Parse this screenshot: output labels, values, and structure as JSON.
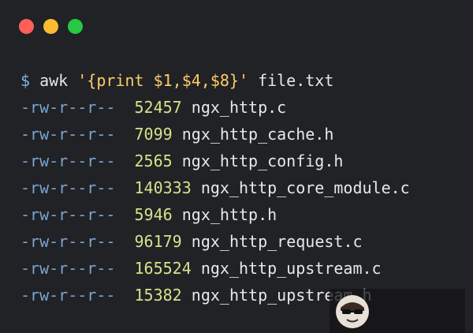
{
  "window": {
    "controls": [
      {
        "name": "close",
        "color": "#ff5f57"
      },
      {
        "name": "minimize",
        "color": "#febc2e"
      },
      {
        "name": "maximize",
        "color": "#28c840"
      }
    ]
  },
  "command": {
    "prompt": "$",
    "program": "awk",
    "script": "'{print $1,$4,$8}'",
    "file": "file.txt"
  },
  "rows": [
    {
      "perm": "-rw-r--r--",
      "size": "52457",
      "name": "ngx_http.c"
    },
    {
      "perm": "-rw-r--r--",
      "size": "7099",
      "name": "ngx_http_cache.h"
    },
    {
      "perm": "-rw-r--r--",
      "size": "2565",
      "name": "ngx_http_config.h"
    },
    {
      "perm": "-rw-r--r--",
      "size": "140333",
      "name": "ngx_http_core_module.c"
    },
    {
      "perm": "-rw-r--r--",
      "size": "5946",
      "name": "ngx_http.h"
    },
    {
      "perm": "-rw-r--r--",
      "size": "96179",
      "name": "ngx_http_request.c"
    },
    {
      "perm": "-rw-r--r--",
      "size": "165524",
      "name": "ngx_http_upstream.c"
    },
    {
      "perm": "-rw-r--r--",
      "size": "15382",
      "name": "ngx_http_upstream.h"
    }
  ],
  "overlay": {
    "icon": "avatar-icon"
  }
}
